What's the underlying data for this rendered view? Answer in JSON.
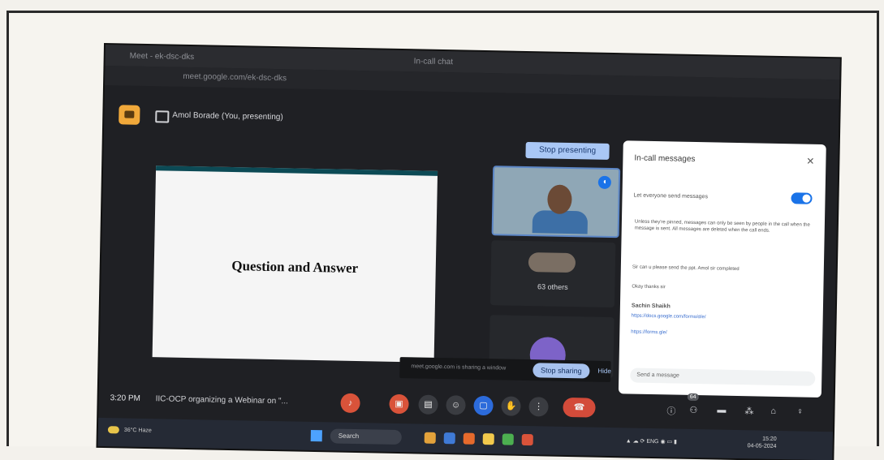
{
  "browser": {
    "tabs": [
      "Meet - ek-dsc-dks",
      "In-call chat"
    ],
    "address": "meet.google.com/ek-dsc-dks"
  },
  "meet": {
    "presenter_title": "Amol Borade (You, presenting)",
    "stop_presenting_label": "Stop presenting",
    "slide_title": "Question and Answer",
    "others_label": "63 others",
    "share_bar_text": "meet.google.com is sharing a window",
    "stop_sharing_label": "Stop sharing",
    "hide_label": "Hide"
  },
  "chat": {
    "title": "In-call messages",
    "toggle_label": "Let everyone send messages",
    "note": "Unless they're pinned, messages can only be seen by people in the call when the message is sent. All messages are deleted when the call ends.",
    "messages": [
      {
        "text": "Sir can u please send the ppt. Amol sir completed"
      },
      {
        "text": "Okay thanks sir"
      }
    ],
    "sender": "Sachin Shaikh",
    "links": [
      "https://docs.google.com/forms/d/e/",
      "https://forms.gle/"
    ],
    "input_placeholder": "Send a message"
  },
  "controls": {
    "time": "3:20 PM",
    "meeting_name": "IIC-OCP organizing a Webinar on \"...",
    "people_count": "64"
  },
  "taskbar": {
    "weather_temp": "36°C",
    "weather_desc": "Haze",
    "search_label": "Search",
    "lang": "ENG",
    "time": "15:20",
    "date": "04-05-2024"
  },
  "colors": {
    "meet_bg": "#1f2024",
    "accent": "#a9c7f5",
    "end_call": "#d34b3a",
    "toggle": "#1a73e8"
  }
}
